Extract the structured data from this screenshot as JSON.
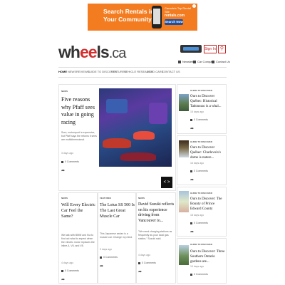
{
  "ad": {
    "headline_1": "Search Rentals in",
    "headline_2": "Your Community",
    "small_text": "Canada's Top Rental Site",
    "brand": "rentals.com",
    "button_label": "Search Now"
  },
  "header": {
    "logo_main": "wheels",
    "logo_suffix": ".ca",
    "signin_label": "Sign In",
    "utility": [
      {
        "label": "Newsletter",
        "icon": "mail-icon"
      },
      {
        "label": "Car Compare",
        "icon": "compare-icon"
      },
      {
        "label": "Contact Us",
        "icon": "contact-icon"
      }
    ]
  },
  "nav": {
    "items": [
      "HOME",
      "NEWS",
      "REVIEWS",
      "GUIDE TO DISCOVER",
      "FEATURES",
      "VEHICLE RESEARCH",
      "USED CARS",
      "CONTACT US"
    ]
  },
  "feature": {
    "tag": "NEWS",
    "headline": "Five reasons why Pfaff sees value in going racing",
    "excerpt": "Sure, motorsport is expensive, but Pfaff says the returns it sees are multidimensional.",
    "time": "3 days ago",
    "comments": "0 Comments",
    "arrows_label": "< >"
  },
  "articles": [
    {
      "tag": "NEWS",
      "headline": "Will Every Electric Car Feel the Same?",
      "excerpt": "We talk with BMW and Kia to find out what to expect when the electric motor replaces the inline-4, V6, and V8.",
      "time": "4 days ago",
      "comments": "0 Comments"
    },
    {
      "tag": "FEATURES",
      "headline": "The Lotus SS 500 Is The Last Great Muscle Car",
      "excerpt": "This Japanese sedan is a muscle car. Change my mind.",
      "time": "3 days ago",
      "comments": "0 Comments"
    },
    {
      "tag": "NEWS",
      "headline": "David Suzuki reflects on his experience driving from Vancouver to...",
      "excerpt": "\"We need charging stations as frequently as your local gas station,\" Suzuki said.",
      "time": "4 days ago",
      "comments": "0 Comments"
    }
  ],
  "sidebar": [
    {
      "tag": "GUIDE TO DISCOVER",
      "headline": "Ours to Discover Québec: Historical Tadoussac is a whal...",
      "time": "15 days ago",
      "comments": "0 Comments"
    },
    {
      "tag": "GUIDE TO DISCOVER",
      "headline": "Ours to Discover Québec: Charlevoix's dome is nature...",
      "time": "16 days ago",
      "comments": "0 Comments"
    },
    {
      "tag": "GUIDE TO DISCOVER",
      "headline": "Ours to Discover: The Bounty of Prince Edward County",
      "time": "18 days ago",
      "comments": "0 Comments"
    },
    {
      "tag": "GUIDE TO DISCOVER",
      "headline": "Ours to Discover: Three Southern Ontario gardens are...",
      "time": "19 days ago",
      "comments": "0 Comments"
    }
  ]
}
